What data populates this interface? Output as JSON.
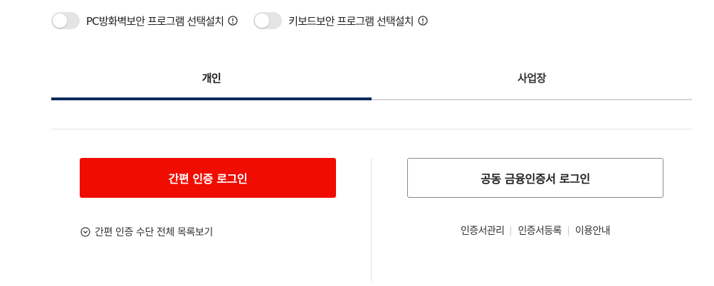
{
  "security_options": [
    {
      "label": "PC방화벽보안 프로그램 선택설치",
      "enabled": false,
      "icon": "info-circle-icon"
    },
    {
      "label": "키보드보안 프로그램 선택설치",
      "enabled": false,
      "icon": "info-circle-icon"
    }
  ],
  "tabs": [
    {
      "label": "개인",
      "active": true
    },
    {
      "label": "사업장",
      "active": false
    }
  ],
  "login": {
    "simple_auth_label": "간편 인증 로그인",
    "view_all_methods_label": "간편 인증 수단 전체 목록보기",
    "joint_cert_label": "공동 금융인증서 로그인",
    "cert_links": [
      "인증서관리",
      "인증서등록",
      "이용안내"
    ]
  },
  "colors": {
    "primary_red": "#f00c00",
    "active_tab_navy": "#0c2b5c",
    "toggle_off": "#e4e4e4"
  }
}
